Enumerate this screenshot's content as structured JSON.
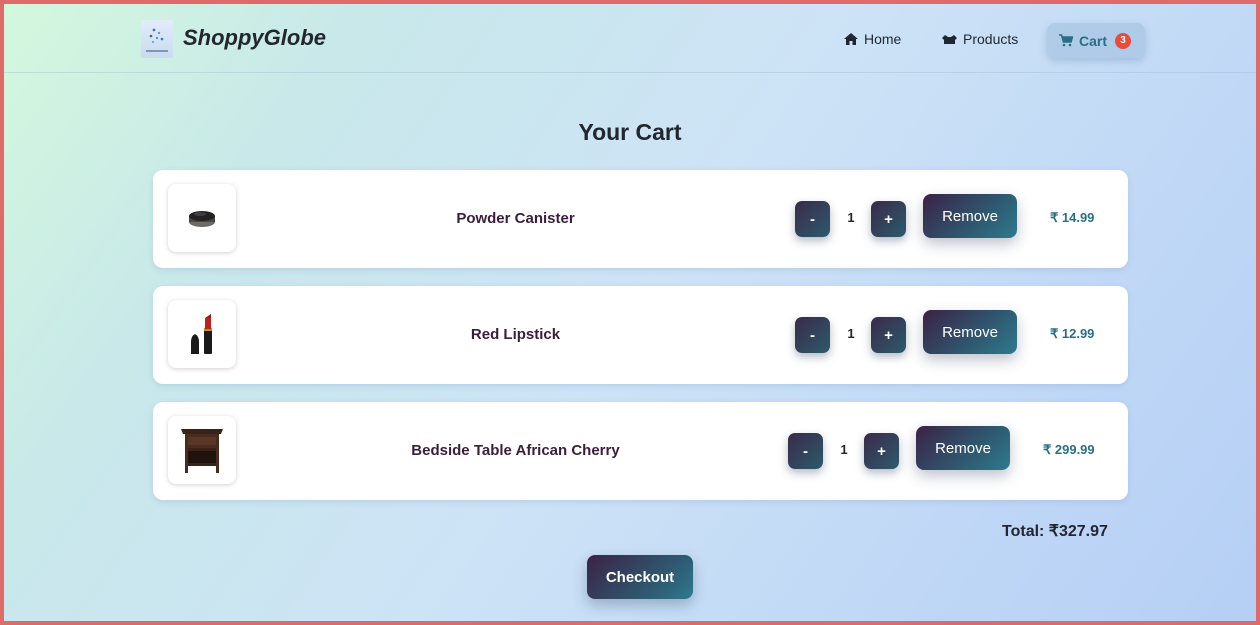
{
  "header": {
    "brand": "ShoppyGlobe",
    "nav": {
      "home": "Home",
      "products": "Products",
      "cart": "Cart",
      "cart_count": "3"
    },
    "icons": {
      "logo": "logo-icon",
      "home": "home-icon",
      "products": "products-icon",
      "cart": "cart-icon"
    }
  },
  "main": {
    "title": "Your Cart",
    "items": [
      {
        "name": "Powder Canister",
        "quantity": "1",
        "minus": "-",
        "plus": "+",
        "remove": "Remove",
        "price": "₹ 14.99",
        "image": "powder-canister-image"
      },
      {
        "name": "Red Lipstick",
        "quantity": "1",
        "minus": "-",
        "plus": "+",
        "remove": "Remove",
        "price": "₹ 12.99",
        "image": "red-lipstick-image"
      },
      {
        "name": "Bedside Table African Cherry",
        "quantity": "1",
        "minus": "-",
        "plus": "+",
        "remove": "Remove",
        "price": "₹ 299.99",
        "image": "bedside-table-image"
      }
    ],
    "total": "Total: ₹327.97",
    "checkout": "Checkout"
  },
  "colors": {
    "accent": "#2a6f86",
    "button_dark": "#3b2245",
    "badge": "#e74c3c",
    "frame_border": "#de6a6a"
  }
}
